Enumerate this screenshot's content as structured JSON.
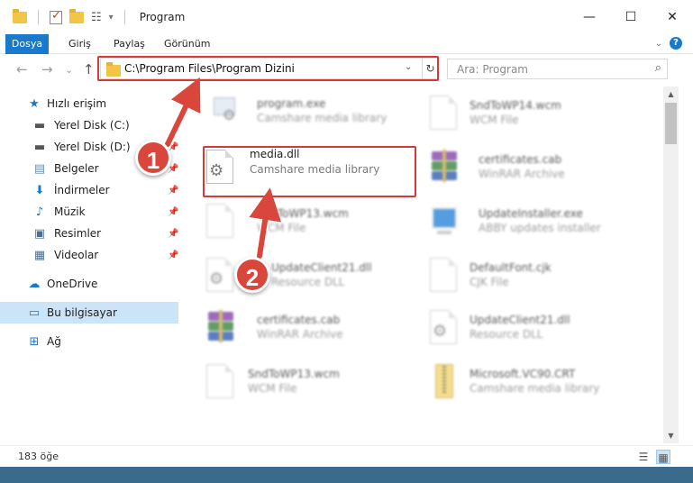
{
  "window": {
    "title": "Program",
    "controls": {
      "minimize": "—",
      "maximize": "☐",
      "close": "✕"
    }
  },
  "ribbon": {
    "tabs": [
      "Dosya",
      "Giriş",
      "Paylaş",
      "Görünüm"
    ]
  },
  "nav": {
    "back": "←",
    "forward": "→",
    "recent": "⌄",
    "up": "↑",
    "address": "C:\\Program Files\\Program Dizini",
    "search_placeholder": "Ara: Program"
  },
  "sidebar": {
    "items": [
      {
        "label": "Hızlı erişim",
        "icon": "star-icon"
      },
      {
        "label": "Yerel Disk (C:)",
        "icon": "drive-icon"
      },
      {
        "label": "Yerel Disk (D:)",
        "icon": "drive-icon"
      },
      {
        "label": "Belgeler",
        "icon": "documents-icon"
      },
      {
        "label": "İndirmeler",
        "icon": "downloads-icon"
      },
      {
        "label": "Müzik",
        "icon": "music-icon"
      },
      {
        "label": "Resimler",
        "icon": "pictures-icon"
      },
      {
        "label": "Videolar",
        "icon": "videos-icon"
      },
      {
        "label": "OneDrive",
        "icon": "cloud-icon"
      },
      {
        "label": "Bu bilgisayar",
        "icon": "computer-icon"
      },
      {
        "label": "Ağ",
        "icon": "network-icon"
      }
    ]
  },
  "files": {
    "left": [
      {
        "name": "program.exe",
        "type": "Camshare media library"
      },
      {
        "name": "media.dll",
        "type": "Camshare media library"
      },
      {
        "name": "SndToWP13.wcm",
        "type": "WCM File"
      },
      {
        "name": "UpdateClient21.dll",
        "type": "Resource DLL"
      },
      {
        "name": "certificates.cab",
        "type": "WinRAR Archive"
      },
      {
        "name": "SndToWP13.wcm",
        "type": "WCM File"
      }
    ],
    "right": [
      {
        "name": "SndToWP14.wcm",
        "type": "WCM File"
      },
      {
        "name": "certificates.cab",
        "type": "WinRAR Archive"
      },
      {
        "name": "UpdateInstaller.exe",
        "type": "ABBY updates installer"
      },
      {
        "name": "DefaultFont.cjk",
        "type": "CJK File"
      },
      {
        "name": "UpdateClient21.dll",
        "type": "Resource DLL"
      },
      {
        "name": "Microsoft.VC90.CRT",
        "type": "Camshare media library"
      }
    ]
  },
  "status": {
    "count": "183 öğe"
  },
  "annotations": {
    "step1": "1",
    "step2": "2",
    "highlight_color": "#d33a3a"
  }
}
